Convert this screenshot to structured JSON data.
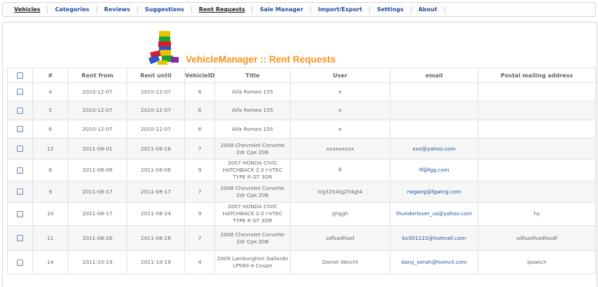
{
  "menu": [
    {
      "label": "Vehicles",
      "active": true
    },
    {
      "label": "Categories"
    },
    {
      "label": "Reviews"
    },
    {
      "label": "Suggestions"
    },
    {
      "label": "Rent Requests",
      "active": true
    },
    {
      "label": "Sale Manager"
    },
    {
      "label": "Import/Export"
    },
    {
      "label": "Settings"
    },
    {
      "label": "About"
    }
  ],
  "page_title": "VehicleManager :: Rent Requests",
  "table": {
    "headers": [
      "#",
      "Rent from",
      "Rent until",
      "VehicleID",
      "Title",
      "User",
      "email",
      "Postal mailing address"
    ],
    "rows": [
      {
        "num": "4",
        "from": "2010-12-07",
        "until": "2010-12-07",
        "vid": "6",
        "title": "Alfa Romeo 155",
        "user": "e",
        "email": "",
        "address": ""
      },
      {
        "num": "5",
        "from": "2010-12-07",
        "until": "2010-12-07",
        "vid": "6",
        "title": "Alfa Romeo 155",
        "user": "e",
        "email": "",
        "address": ""
      },
      {
        "num": "6",
        "from": "2010-12-07",
        "until": "2010-12-07",
        "vid": "6",
        "title": "Alfa Romeo 155",
        "user": "e",
        "email": "",
        "address": ""
      },
      {
        "num": "12",
        "from": "2011-08-01",
        "until": "2011-08-16",
        "vid": "7",
        "title": "2008 Chevrolet Corvette 2dr Cpe Z06",
        "user": "xxxxxxxxx",
        "email": "xxx@yahoo.com",
        "address": ""
      },
      {
        "num": "8",
        "from": "2011-08-06",
        "until": "2011-08-06",
        "vid": "9",
        "title": "2007 HONDA CIVIC HATCHBACK 2.0 I-VTEC TYPE R GT 3DR",
        "user": "ff",
        "email": "ff@fgg.com",
        "address": ""
      },
      {
        "num": "9",
        "from": "2011-08-17",
        "until": "2011-08-17",
        "vid": "7",
        "title": "2008 Chevrolet Corvette 2dr Cpe Z06",
        "user": "trg3254tg254gt4",
        "email": "rwgwrg@fgwtrg.com",
        "address": ""
      },
      {
        "num": "10",
        "from": "2011-08-17",
        "until": "2011-08-24",
        "vid": "9",
        "title": "2007 HONDA CIVIC HATCHBACK 2.0 I-VTEC TYPE R GT 3DR",
        "user": "ghggh",
        "email": "thunderlover_us@yahoo.com",
        "address": "hy"
      },
      {
        "num": "11",
        "from": "2011-08-26",
        "until": "2011-08-26",
        "vid": "7",
        "title": "2008 Chevrolet Corvette 2dr Cpe Z06",
        "user": "sdfsadfsad",
        "email": "bc001122@hotmail.com",
        "address": "sdfsadfsadfasdf"
      },
      {
        "num": "14",
        "from": "2011-10-19",
        "until": "2011-10-19",
        "vid": "4",
        "title": "2009 Lamborghini Gallardo LP560-4 Coupe",
        "user": "Daniel Weicht",
        "email": "dany_verah@homcil.com",
        "address": "Ipswich"
      }
    ]
  },
  "colors": {
    "title": "#f7941e",
    "link": "#1f4f9e"
  },
  "icons": {
    "logo": "toy-blocks-logo-icon"
  }
}
